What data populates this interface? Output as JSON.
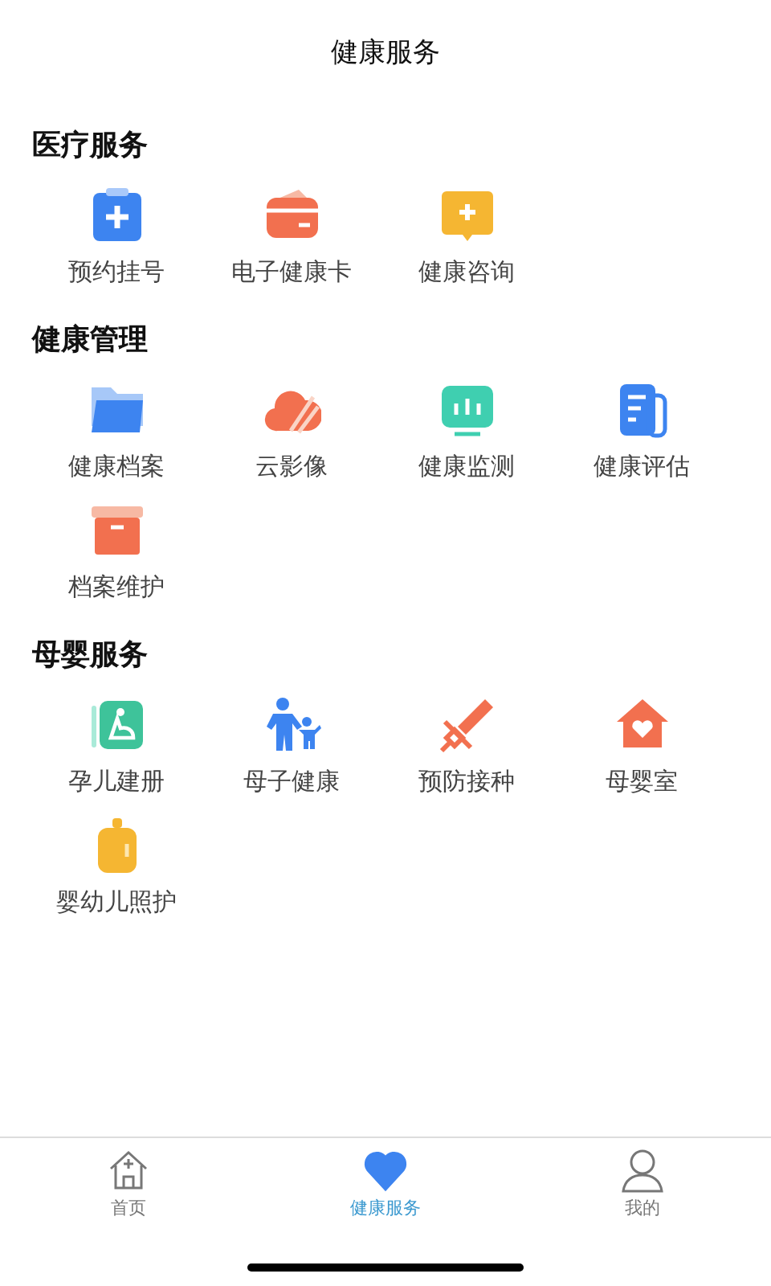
{
  "header": {
    "title": "健康服务"
  },
  "sections": [
    {
      "title": "医疗服务",
      "items": [
        {
          "label": "预约挂号",
          "kind": "clipboard"
        },
        {
          "label": "电子健康卡",
          "kind": "card"
        },
        {
          "label": "健康咨询",
          "kind": "chat"
        }
      ]
    },
    {
      "title": "健康管理",
      "items": [
        {
          "label": "健康档案",
          "kind": "folder"
        },
        {
          "label": "云影像",
          "kind": "cloud"
        },
        {
          "label": "健康监测",
          "kind": "monitor"
        },
        {
          "label": "健康评估",
          "kind": "document"
        },
        {
          "label": "档案维护",
          "kind": "archive"
        }
      ]
    },
    {
      "title": "母婴服务",
      "items": [
        {
          "label": "孕儿建册",
          "kind": "pregnant"
        },
        {
          "label": "母子健康",
          "kind": "family"
        },
        {
          "label": "预防接种",
          "kind": "syringe"
        },
        {
          "label": "母婴室",
          "kind": "house"
        },
        {
          "label": "婴幼儿照护",
          "kind": "bottle"
        }
      ]
    }
  ],
  "tabs": [
    {
      "label": "首页",
      "kind": "home",
      "selected": false
    },
    {
      "label": "健康服务",
      "kind": "heart",
      "selected": true
    },
    {
      "label": "我的",
      "kind": "person",
      "selected": false
    }
  ]
}
